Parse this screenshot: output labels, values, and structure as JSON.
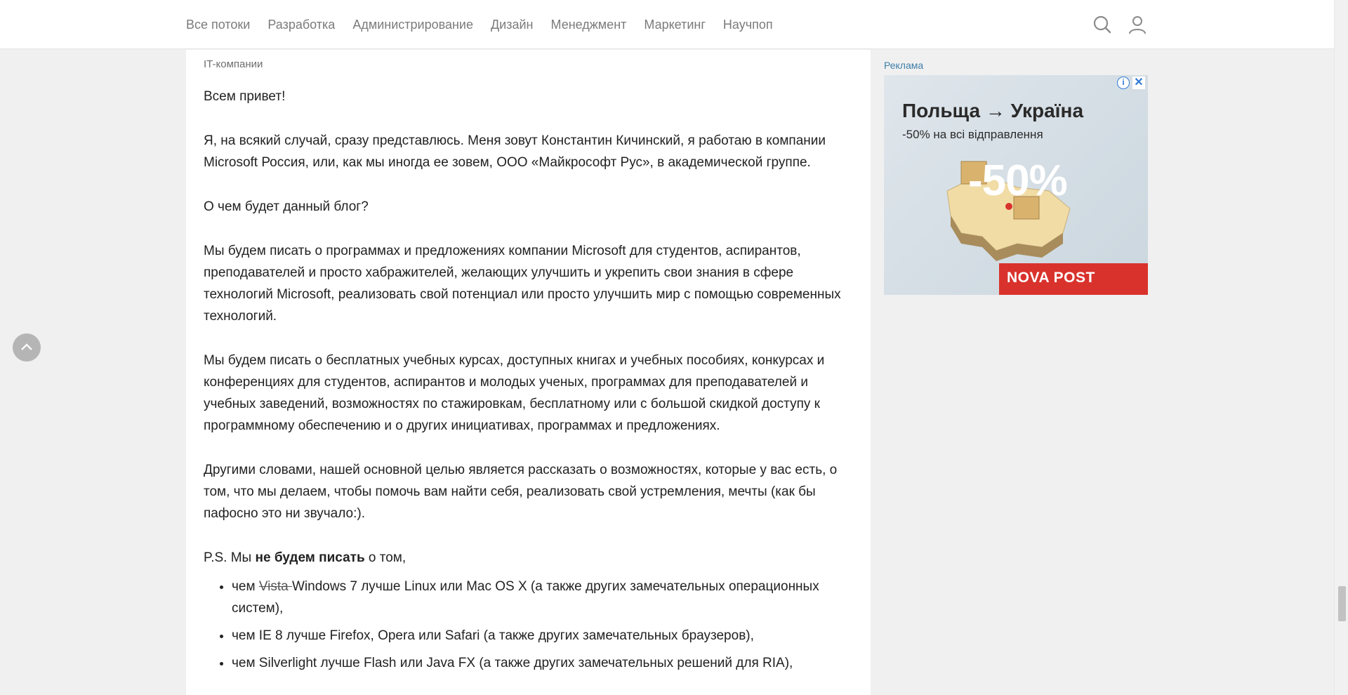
{
  "nav": {
    "items": [
      "Все потоки",
      "Разработка",
      "Администрирование",
      "Дизайн",
      "Менеджмент",
      "Маркетинг",
      "Научпоп"
    ]
  },
  "article": {
    "hub": "IT-компании",
    "greeting": "Всем привет!",
    "intro": "Я, на всякий случай, сразу представлюсь. Меня зовут Константин Кичинский, я работаю в компании Microsoft Россия, или, как мы иногда ее зовем, ООО «Майкрософт Рус», в академической группе.",
    "question": "О чем будет данный блог?",
    "para1": "Мы будем писать о программах и предложениях компании Microsoft для студентов, аспирантов, преподавателей и просто хабражителей, желающих улучшить и укрепить свои знания в сфере технологий Microsoft, реализовать свой потенциал или просто улучшить мир с помощью современных технологий.",
    "para2": "Мы будем писать о бесплатных учебных курсах, доступных книгах и учебных пособиях, конкурсах и конференциях для студентов, аспирантов и молодых ученых, программах для преподавателей и учебных заведений, возможностях по стажировкам, бесплатному или с большой скидкой доступу к программному обеспечению и о других инициативах, программах и предложениях.",
    "para3": "Другими словами, нашей основной целью является рассказать о возможностях, которые у вас есть, о том, что мы делаем, чтобы помочь вам найти себя, реализовать свой устремления, мечты (как бы пафосно это ни звучало:).",
    "ps_prefix": "P.S. Мы ",
    "ps_bold": "не будем писать",
    "ps_suffix": " о том,",
    "list": {
      "item1_prefix": "чем ",
      "item1_strike": "Vista ",
      "item1_rest": "Windows 7 лучше Linux или Mac OS X (а также других замечательных операционных систем),",
      "item2": "чем IE 8 лучше Firefox, Opera или Safari (а также других замечательных браузеров),",
      "item3": "чем Silverlight лучше Flash или Java FX (а также других замечательных решений для RIA),"
    }
  },
  "ad": {
    "label": "Реклама",
    "title": "Польща → Україна",
    "subtitle": "-50% на всі відправлення",
    "big": "-50%",
    "brand": "NOVA POST",
    "info": "i",
    "close": "✕"
  },
  "colors": {
    "accent_link": "#3f7ea9",
    "brand_red": "#d9322c"
  },
  "icons": [
    "search-icon",
    "user-icon",
    "chevron-up-icon",
    "info-icon",
    "close-icon"
  ]
}
